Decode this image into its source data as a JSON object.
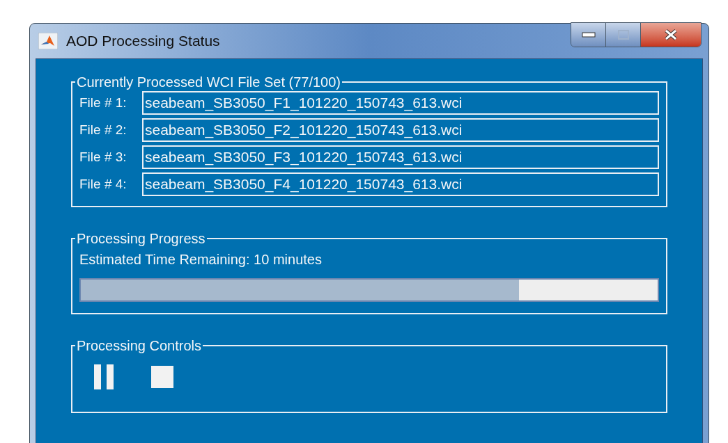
{
  "window": {
    "title": "AOD Processing Status"
  },
  "file_set": {
    "title": "Currently Processed WCI File Set (77/100)",
    "files": [
      {
        "label": "File # 1:",
        "value": "seabeam_SB3050_F1_101220_150743_613.wci"
      },
      {
        "label": "File # 2:",
        "value": "seabeam_SB3050_F2_101220_150743_613.wci"
      },
      {
        "label": "File # 3:",
        "value": "seabeam_SB3050_F3_101220_150743_613.wci"
      },
      {
        "label": "File # 4:",
        "value": "seabeam_SB3050_F4_101220_150743_613.wci"
      }
    ]
  },
  "progress": {
    "title": "Processing Progress",
    "status": "Estimated Time Remaining: 10 minutes",
    "level": 0.76
  },
  "controls": {
    "title": "Processing Controls",
    "buttons": [
      {
        "kind": "pause"
      },
      {
        "kind": "stop"
      }
    ]
  }
}
